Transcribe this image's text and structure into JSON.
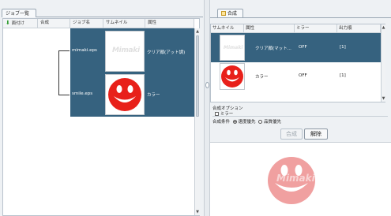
{
  "left": {
    "tab_label": "ジョブ一覧",
    "headers": [
      "面付け",
      "合成",
      "ジョブ名",
      "サムネイル",
      "属性"
    ],
    "jobs": [
      {
        "name": "mimaki.eps",
        "thumb_text": "Mimaki",
        "attribute": "クリア顔(アット調)"
      },
      {
        "name": "smile.eps",
        "thumb_text": "",
        "attribute": "カラー"
      }
    ]
  },
  "right": {
    "tab_label": "合成",
    "headers": [
      "サムネイル",
      "属性",
      "ミラー",
      "出力順"
    ],
    "rows": [
      {
        "attribute": "クリア顔(マット...",
        "mirror": "OFF",
        "order": "[1]",
        "thumb_text": "Mimaki"
      },
      {
        "attribute": "カラー",
        "mirror": "OFF",
        "order": "[1]",
        "thumb_text": ""
      }
    ],
    "options": {
      "title": "合成オプション",
      "mirror_label": "ミラー",
      "condition_label": "合成条件",
      "speed_label": "速度優先",
      "quality_label": "品質優先"
    },
    "buttons": {
      "compose": "合成",
      "release": "解除"
    },
    "preview_text": "Mimaki"
  },
  "colors": {
    "selection": "#36627f",
    "smiley_red": "#e8201a",
    "preview_pink": "#f0a0a0"
  }
}
